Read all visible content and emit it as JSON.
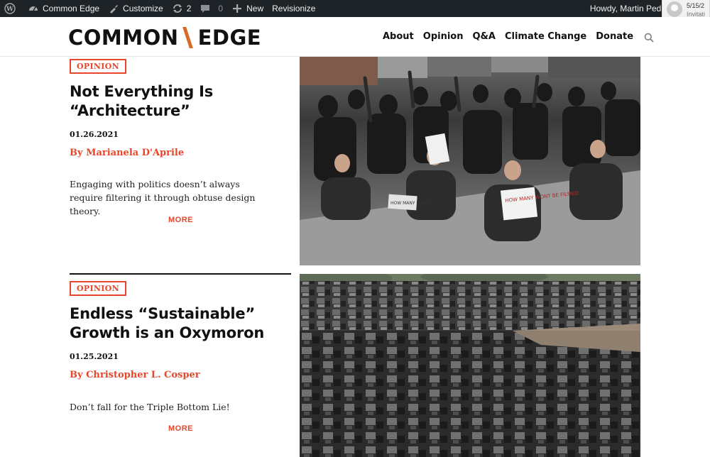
{
  "admin_bar": {
    "site_name": "Common Edge",
    "customize": "Customize",
    "revisions_count": "2",
    "comments_count": "0",
    "new_label": "New",
    "revisionize": "Revisionize",
    "greeting": "Howdy, Martin Pede"
  },
  "notification": {
    "date": "5/15/2",
    "text": "Invitati"
  },
  "site": {
    "logo_left": "COMMON",
    "logo_right": "EDGE",
    "accent_color": "#d86a25"
  },
  "nav": {
    "items": [
      "About",
      "Opinion",
      "Q&A",
      "Climate Change",
      "Donate"
    ]
  },
  "articles": [
    {
      "category": "OPINION",
      "title": "Not Everything Is “Architecture”",
      "date": "01.26.2021",
      "author": "By Marianela D'Aprile",
      "excerpt": "Engaging with politics doesn’t always require filtering it through obtuse design theory.",
      "more": "MORE",
      "image_sign_1": "HOW MANY MORE?",
      "image_sign_2": "HOW MANY WONT BE FILMED"
    },
    {
      "category": "OPINION",
      "title": "Endless “Sustainable” Growth is an Oxymoron",
      "date": "01.25.2021",
      "author": "By Christopher L. Cosper",
      "excerpt": "Don’t fall for the Triple Bottom Lie!",
      "more": "MORE"
    }
  ],
  "colors": {
    "accent_red": "#e8462b",
    "admin_bar_bg": "#1d2327"
  }
}
